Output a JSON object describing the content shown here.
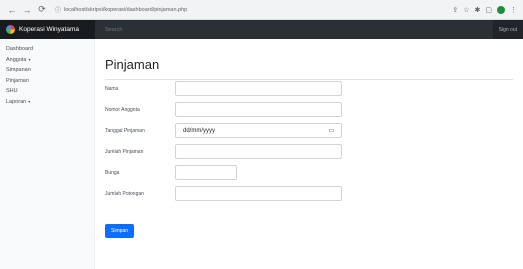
{
  "browser": {
    "url": "localhost/skripsi/koperasi/dashboard/pinjaman.php",
    "icons": [
      "back-icon",
      "forward-icon",
      "reload-icon",
      "info-icon",
      "share-icon",
      "star-icon",
      "extensions-icon",
      "sidepanel-icon",
      "profile-icon",
      "menu-icon"
    ]
  },
  "app": {
    "brand": "Koperasi Winyatama",
    "search_placeholder": "Search",
    "signout": "Sign out"
  },
  "sidebar": {
    "items": [
      {
        "label": "Dashboard"
      },
      {
        "label": "Anggota",
        "caret": "▾"
      },
      {
        "label": "Simpanan"
      },
      {
        "label": "Pinjaman"
      },
      {
        "label": "SHU"
      },
      {
        "label": "Laporan",
        "caret": "▾"
      }
    ]
  },
  "main": {
    "title": "Pinjaman",
    "fields": [
      {
        "label": "Nama",
        "value": ""
      },
      {
        "label": "Nomor Anggota",
        "value": ""
      },
      {
        "label": "Tanggal Pinjaman",
        "value": "dd/mm/yyyy"
      },
      {
        "label": "Jumlah Pinjaman",
        "value": ""
      },
      {
        "label": "Bunga",
        "value": ""
      },
      {
        "label": "Jumlah Potongan",
        "value": ""
      }
    ],
    "submit_label": "Simpan"
  },
  "colors": {
    "accent": "#0d6efd",
    "navbar": "#212529"
  }
}
